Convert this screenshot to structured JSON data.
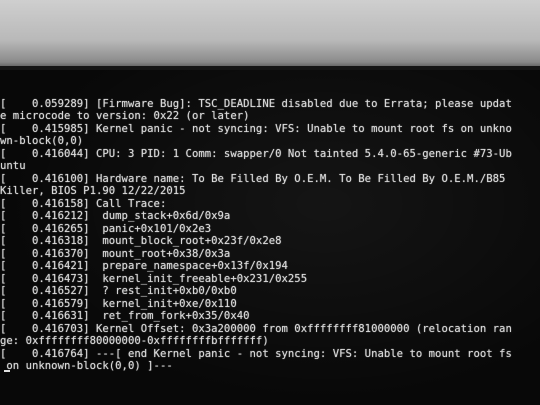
{
  "console": {
    "lines": [
      "[    0.059289] [Firmware Bug]: TSC_DEADLINE disabled due to Errata; please updat",
      "e microcode to version: 0x22 (or later)",
      "[    0.415985] Kernel panic - not syncing: VFS: Unable to mount root fs on unkno",
      "wn-block(0,0)",
      "[    0.416044] CPU: 3 PID: 1 Comm: swapper/0 Not tainted 5.4.0-65-generic #73-Ub",
      "untu",
      "[    0.416100] Hardware name: To Be Filled By O.E.M. To Be Filled By O.E.M./B85",
      "Killer, BIOS P1.90 12/22/2015",
      "[    0.416158] Call Trace:",
      "[    0.416212]  dump_stack+0x6d/0x9a",
      "[    0.416265]  panic+0x101/0x2e3",
      "[    0.416318]  mount_block_root+0x23f/0x2e8",
      "[    0.416370]  mount_root+0x38/0x3a",
      "[    0.416421]  prepare_namespace+0x13f/0x194",
      "[    0.416473]  kernel_init_freeable+0x231/0x255",
      "[    0.416527]  ? rest_init+0xb0/0xb0",
      "[    0.416579]  kernel_init+0xe/0x110",
      "[    0.416631]  ret_from_fork+0x35/0x40",
      "[    0.416703] Kernel Offset: 0x3a200000 from 0xffffffff81000000 (relocation ran",
      "ge: 0xffffffff80000000-0xffffffffbfffffff)",
      "[    0.416764] ---[ end Kernel panic - not syncing: VFS: Unable to mount root fs",
      " on unknown-block(0,0) ]---"
    ]
  }
}
